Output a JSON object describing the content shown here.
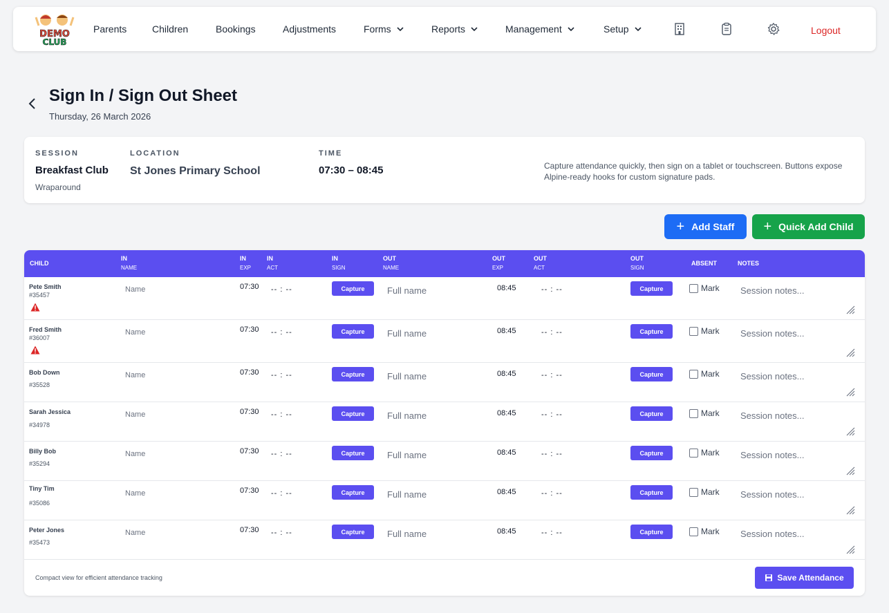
{
  "nav": {
    "logo_text": "DEMO CLUB",
    "items": [
      {
        "label": "Parents"
      },
      {
        "label": "Children"
      },
      {
        "label": "Bookings"
      },
      {
        "label": "Adjustments"
      },
      {
        "label": "Forms"
      },
      {
        "label": "Reports"
      },
      {
        "label": "Management"
      },
      {
        "label": "Setup"
      }
    ],
    "icons": [
      "building-icon",
      "clipboard-icon",
      "gear-icon"
    ],
    "logout": "Logout",
    "logout_color": "#dc2626"
  },
  "page": {
    "title": "Sign In / Sign Out Sheet",
    "date": "Thursday, 26 March 2026"
  },
  "session": {
    "session_label": "SESSION",
    "session_value": "Breakfast Club",
    "session_sub": "Wraparound",
    "location_label": "LOCATION",
    "location_value": "St Jones Primary School",
    "time_label": "TIME",
    "time_value": "07:30 – 08:45",
    "note": "Capture attendance quickly, then sign on a tablet or touchscreen. Buttons expose Alpine-ready hooks for custom signature pads."
  },
  "actions": {
    "add_staff": "Add Staff",
    "quick_add_child": "Quick Add Child",
    "add_staff_color": "#1d6cf5",
    "quick_add_color": "#16a34a"
  },
  "table": {
    "header_color": "#5b4ef0",
    "headers": {
      "child": "CHILD",
      "in_name": [
        "IN",
        "NAME"
      ],
      "in_exp": [
        "IN",
        "EXP"
      ],
      "in_act": [
        "IN",
        "ACT"
      ],
      "in_sign": [
        "IN",
        "SIGN"
      ],
      "out_name": [
        "OUT",
        "NAME"
      ],
      "out_exp": [
        "OUT",
        "EXP"
      ],
      "out_act": [
        "OUT",
        "ACT"
      ],
      "out_sign": [
        "OUT",
        "SIGN"
      ],
      "absent": "ABSENT",
      "notes": "NOTES"
    },
    "placeholders": {
      "in_name": "Name",
      "out_name": "Full name",
      "time": "-- : --",
      "capture": "Capture",
      "mark": "Mark",
      "notes": "Session notes..."
    },
    "rows": [
      {
        "name": "Pete Smith",
        "id": "#35457",
        "warning": true,
        "in_exp": "07:30",
        "out_exp": "08:45"
      },
      {
        "name": "Fred Smith",
        "id": "#36007",
        "warning": true,
        "in_exp": "07:30",
        "out_exp": "08:45"
      },
      {
        "name": "Bob Down",
        "id": "#35528",
        "warning": false,
        "in_exp": "07:30",
        "out_exp": "08:45"
      },
      {
        "name": "Sarah Jessica",
        "id": "#34978",
        "warning": false,
        "in_exp": "07:30",
        "out_exp": "08:45"
      },
      {
        "name": "Billy Bob",
        "id": "#35294",
        "warning": false,
        "in_exp": "07:30",
        "out_exp": "08:45"
      },
      {
        "name": "Tiny Tim",
        "id": "#35086",
        "warning": false,
        "in_exp": "07:30",
        "out_exp": "08:45"
      },
      {
        "name": "Peter Jones",
        "id": "#35473",
        "warning": false,
        "in_exp": "07:30",
        "out_exp": "08:45"
      }
    ],
    "footer_note": "Compact view for efficient attendance tracking",
    "save_label": "Save Attendance"
  }
}
